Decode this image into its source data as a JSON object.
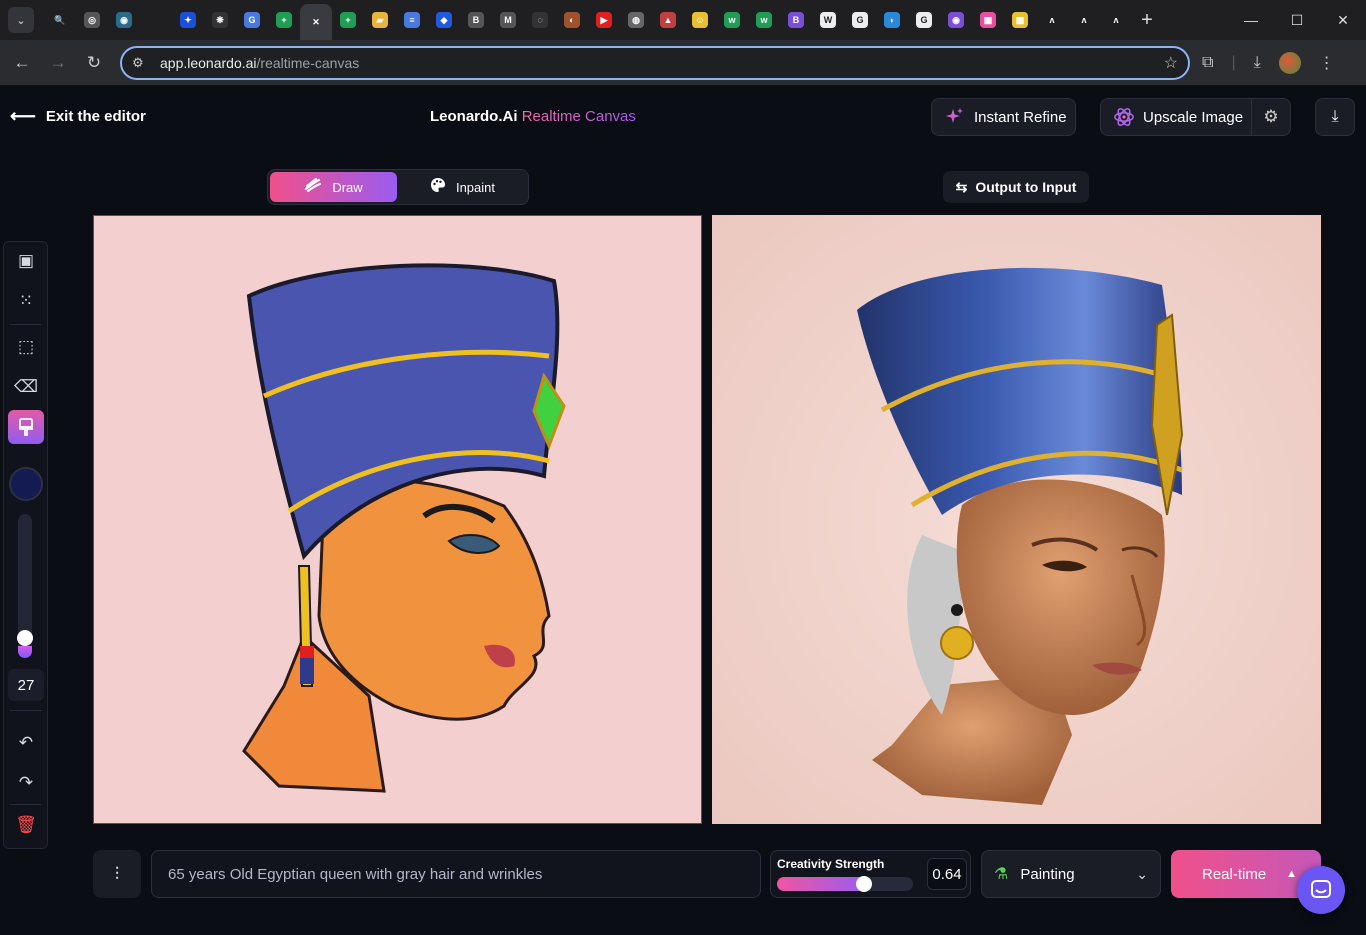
{
  "browser": {
    "tabs": [
      {
        "name": "search-tab",
        "glyph": "🔍",
        "bg": "#1f1f22"
      },
      {
        "name": "gemini-tab",
        "glyph": "◎",
        "bg": "#555"
      },
      {
        "name": "maps-tab",
        "glyph": "◉",
        "bg": "#2a6b8a"
      },
      {
        "name": "blank-tab",
        "glyph": "",
        "bg": "#1f1f22"
      },
      {
        "name": "extensions-tab",
        "glyph": "✦",
        "bg": "#1a4fd8"
      },
      {
        "name": "openai-tab",
        "glyph": "❋",
        "bg": "#333"
      },
      {
        "name": "translate-tab",
        "glyph": "G",
        "bg": "#4a7ae0"
      },
      {
        "name": "sheets-tab",
        "glyph": "+",
        "bg": "#1f9d55"
      },
      {
        "name": "active-tab",
        "glyph": "✕",
        "bg": "#3a3b40"
      },
      {
        "name": "sheets-tab-2",
        "glyph": "+",
        "bg": "#1f9d55"
      },
      {
        "name": "scholar-tab",
        "glyph": "▰",
        "bg": "#e8b53a"
      },
      {
        "name": "docs-tab",
        "glyph": "≡",
        "bg": "#4a7ae0"
      },
      {
        "name": "diamond-tab",
        "glyph": "◆",
        "bg": "#1f5ae0"
      },
      {
        "name": "b-tab",
        "glyph": "B",
        "bg": "#555"
      },
      {
        "name": "m-tab",
        "glyph": "M",
        "bg": "#555"
      },
      {
        "name": "circle-tab",
        "glyph": "◌",
        "bg": "#333"
      },
      {
        "name": "swirl-tab",
        "glyph": "◐",
        "bg": "#a0522d"
      },
      {
        "name": "youtube-tab",
        "glyph": "▶",
        "bg": "#e02020"
      },
      {
        "name": "globe-tab",
        "glyph": "◍",
        "bg": "#666"
      },
      {
        "name": "alien-tab",
        "glyph": "▲",
        "bg": "#c04040"
      },
      {
        "name": "smile-tab",
        "glyph": "☺",
        "bg": "#e8c030"
      },
      {
        "name": "w-tab",
        "glyph": "w",
        "bg": "#1f9d55"
      },
      {
        "name": "w-tab-2",
        "glyph": "w",
        "bg": "#1f9d55"
      },
      {
        "name": "bootstrap-tab",
        "glyph": "B",
        "bg": "#7a4fd8"
      },
      {
        "name": "wikipedia-tab",
        "glyph": "W",
        "bg": "#eee"
      },
      {
        "name": "google-tab",
        "glyph": "G",
        "bg": "#eee"
      },
      {
        "name": "edge-tab",
        "glyph": "◗",
        "bg": "#2a8ad8"
      },
      {
        "name": "google-tab-2",
        "glyph": "G",
        "bg": "#eee"
      },
      {
        "name": "purple-tab",
        "glyph": "◉",
        "bg": "#7a4fd8"
      },
      {
        "name": "colors-tab",
        "glyph": "▦",
        "bg": "#e84fa0"
      },
      {
        "name": "colors-tab-2",
        "glyph": "▦",
        "bg": "#e8c030"
      },
      {
        "name": "leonardo-tab",
        "glyph": "ʌ",
        "bg": "#1f1f22"
      },
      {
        "name": "leonardo-tab-2",
        "glyph": "ʌ",
        "bg": "#1f1f22"
      },
      {
        "name": "leonardo-tab-3",
        "glyph": "ʌ",
        "bg": "#1f1f22"
      }
    ],
    "url_host": "app.leonardo.ai",
    "url_path": "/realtime-canvas"
  },
  "header": {
    "exit_label": "Exit the editor",
    "brand_name": "Leonardo.Ai",
    "brand_product": "Realtime Canvas",
    "instant_refine_label": "Instant Refine",
    "upscale_label": "Upscale Image"
  },
  "modes": {
    "draw_label": "Draw",
    "inpaint_label": "Inpaint",
    "active": "draw"
  },
  "output_to_input_label": "Output to Input",
  "toolbar": {
    "brush_color": "#141a52",
    "brush_size": "27",
    "brush_size_level": 0.08
  },
  "bottom": {
    "prompt_text": "65 years Old Egyptian queen with gray hair and wrinkles",
    "creativity_label": "Creativity Strength",
    "creativity_value": "0.64",
    "creativity_fraction": 0.64,
    "style_label": "Painting",
    "realtime_label": "Real-time"
  },
  "colors": {
    "accent_pink": "#f0508a",
    "accent_purple": "#9b5cf0",
    "left_canvas_bg": "#f4cfd0",
    "right_canvas_bg": "#f0d3cc"
  }
}
